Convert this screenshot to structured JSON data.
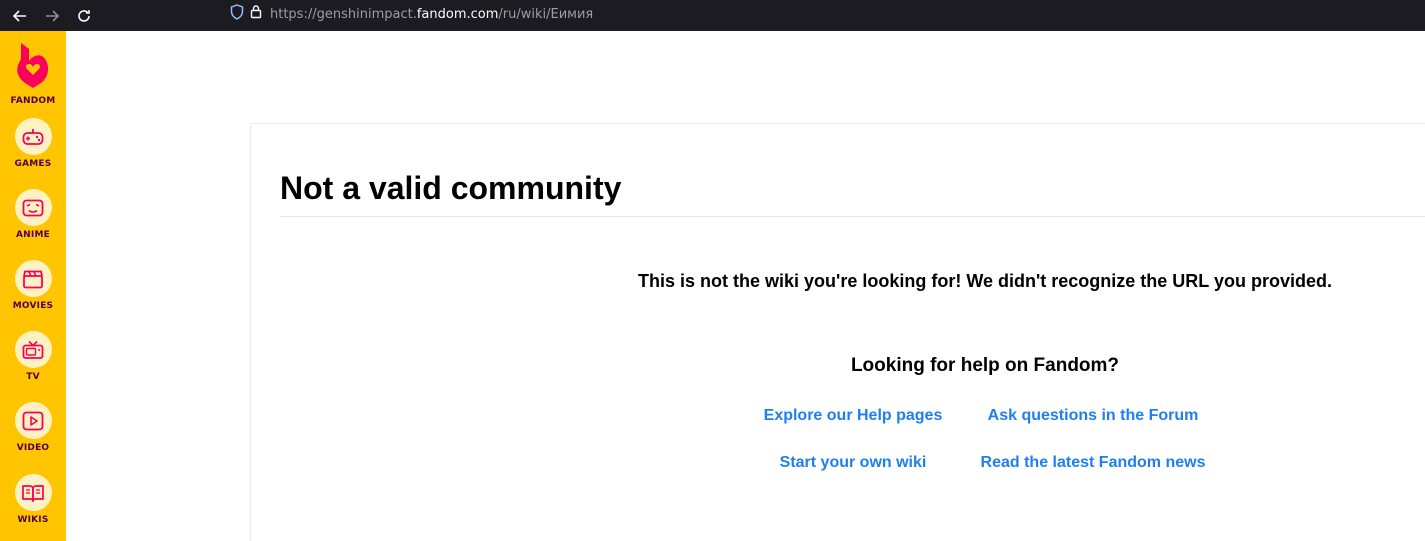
{
  "browser": {
    "url_prefix": "https://genshinimpact.",
    "url_host": "fandom.com",
    "url_path": "/ru/wiki/Еимия",
    "icons": [
      "back-arrow-icon",
      "forward-arrow-icon",
      "reload-icon",
      "shield-icon",
      "lock-icon"
    ]
  },
  "sidebar": {
    "brand_label": "FANDOM",
    "items": [
      {
        "label": "GAMES",
        "icon": "gamepad-icon"
      },
      {
        "label": "ANIME",
        "icon": "anime-face-icon"
      },
      {
        "label": "MOVIES",
        "icon": "clapperboard-icon"
      },
      {
        "label": "TV",
        "icon": "tv-icon"
      },
      {
        "label": "VIDEO",
        "icon": "play-icon"
      },
      {
        "label": "WIKIS",
        "icon": "book-icon"
      }
    ]
  },
  "main": {
    "title": "Not a valid community",
    "message": "This is not the wiki you're looking for! We didn't recognize the URL you provided.",
    "help_heading": "Looking for help on Fandom?",
    "links": {
      "help_pages": "Explore our Help pages",
      "forum": "Ask questions in the Forum",
      "start_wiki": "Start your own wiki",
      "fandom_news": "Read the latest Fandom news"
    }
  },
  "colors": {
    "sidebar_bg": "#ffc500",
    "brand_pink": "#fa005a",
    "label_dark": "#520044",
    "link_blue": "#1f7ff0",
    "browser_bar": "#1c1b22"
  }
}
